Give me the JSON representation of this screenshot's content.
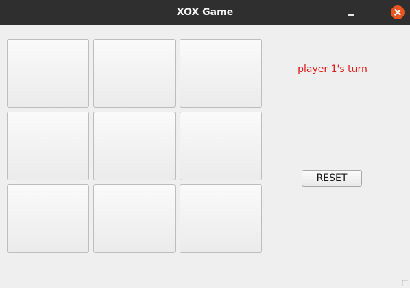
{
  "window": {
    "title": "XOX Game"
  },
  "board": {
    "cells": [
      "",
      "",
      "",
      "",
      "",
      "",
      "",
      "",
      ""
    ]
  },
  "status": {
    "text": "player 1's turn",
    "color": "#e01b1b"
  },
  "controls": {
    "reset_label": "RESET"
  },
  "titlebar_buttons": {
    "close_color": "#e95420"
  }
}
